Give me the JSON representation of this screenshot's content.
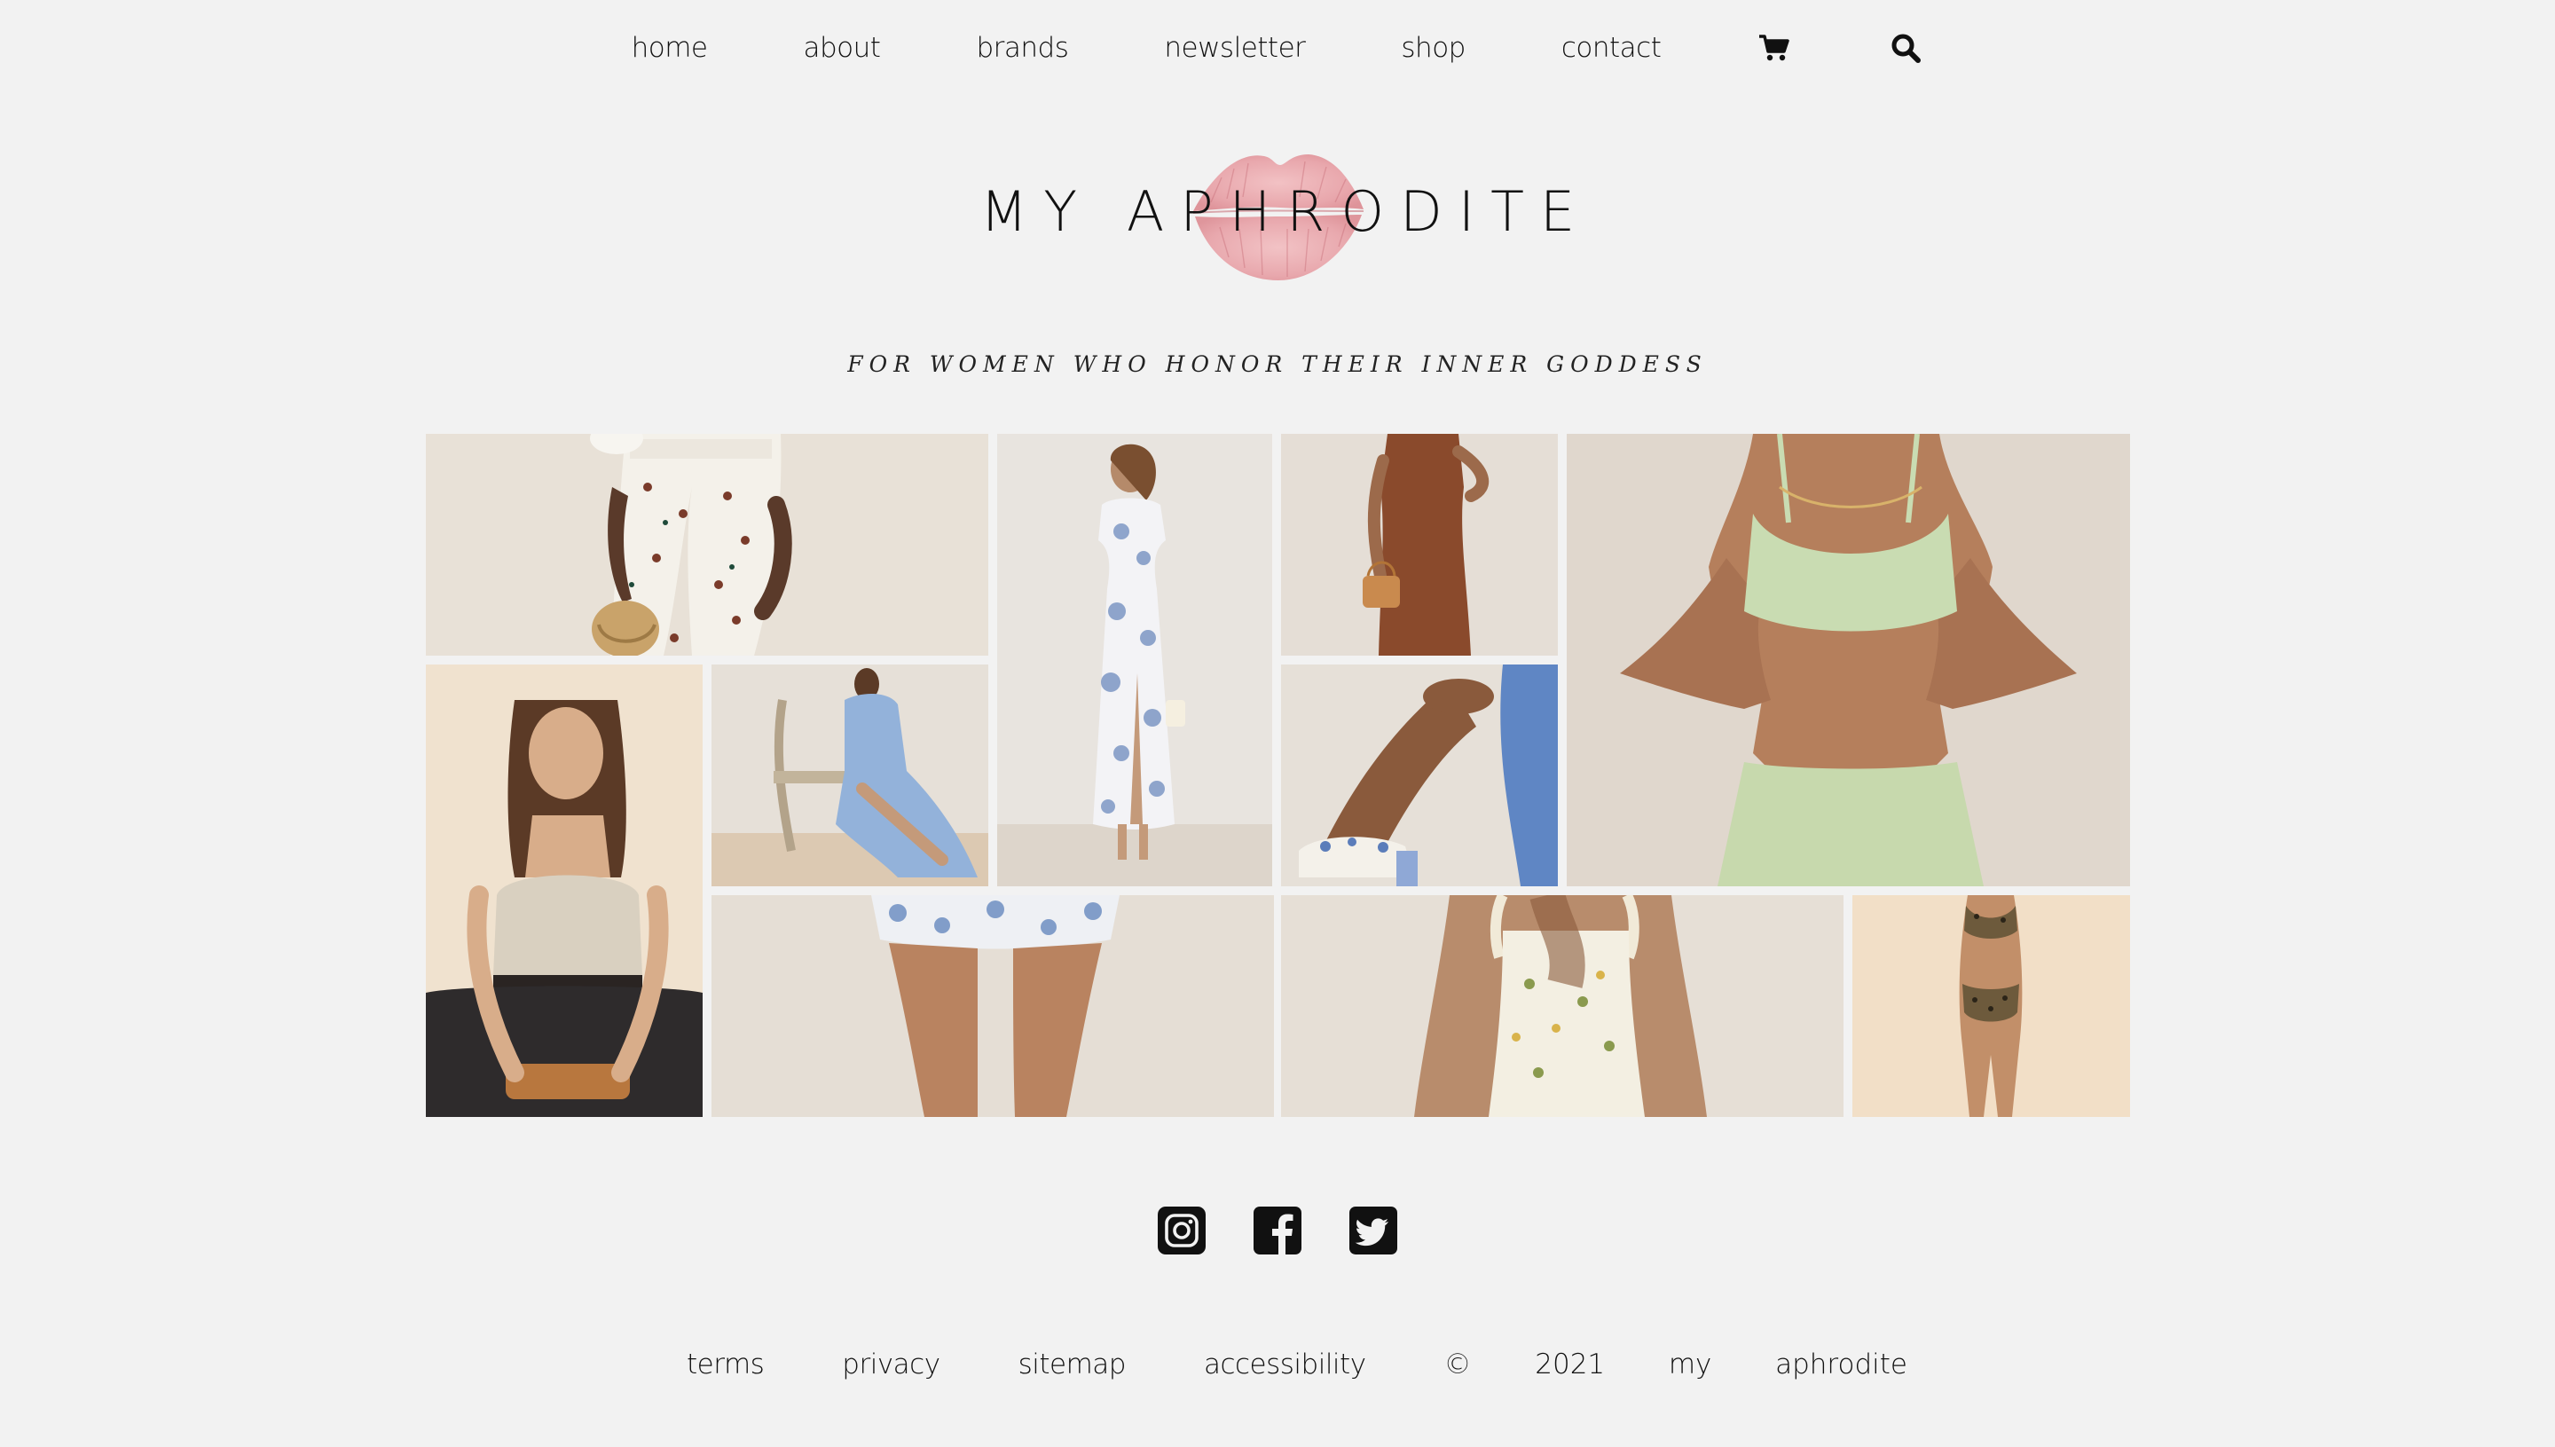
{
  "nav": {
    "items": [
      {
        "label": "home"
      },
      {
        "label": "about"
      },
      {
        "label": "brands"
      },
      {
        "label": "newsletter"
      },
      {
        "label": "shop"
      },
      {
        "label": "contact"
      }
    ],
    "icons": [
      "cart-icon",
      "search-icon"
    ]
  },
  "brand": {
    "logo_text": "MY APHRODITE",
    "tagline": "FOR WOMEN WHO HONOR THEIR INNER GODDESS",
    "lips_color": "#e9a3a8"
  },
  "gallery": {
    "images": [
      "white-floral-jeans-photo",
      "floral-maxi-dress-photo",
      "brown-midi-dress-photo",
      "mint-sports-set-photo",
      "cami-black-jeans-photo",
      "blue-gown-chair-photo",
      "floral-sandal-photo",
      "floral-mini-skirt-photo",
      "floral-smocked-top-photo",
      "leopard-bikini-photo"
    ]
  },
  "social": [
    "instagram-icon",
    "facebook-icon",
    "twitter-icon"
  ],
  "footer": {
    "links": [
      {
        "label": "terms"
      },
      {
        "label": "privacy"
      },
      {
        "label": "sitemap"
      },
      {
        "label": "accessibility"
      }
    ],
    "copyright": "©  2021  my  aphrodite"
  }
}
